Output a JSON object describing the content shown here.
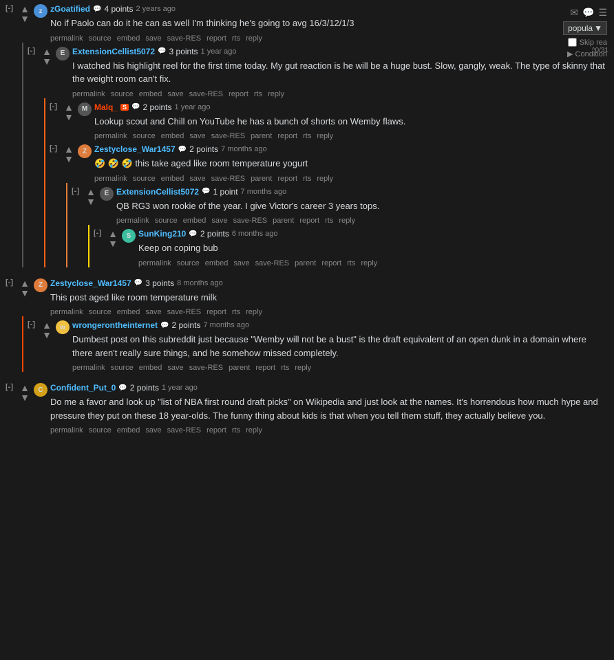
{
  "topRight": {
    "dropdown": "popula",
    "dropdownArrow": "▼",
    "skipRead": "Skip rea",
    "condition": "Condition"
  },
  "counter": "^0/31",
  "comments": [
    {
      "id": "c1",
      "username": "zGoatified",
      "usernameColor": "blue",
      "avatarColor": "blue",
      "avatarInitial": "z",
      "points": "4 points",
      "time": "2 years ago",
      "body": "No if Paolo can do it he can as well I'm thinking he's going to avg 16/3/12/1/3",
      "actions": [
        "permalink",
        "source",
        "embed",
        "save",
        "save-RES",
        "report",
        "rts",
        "reply"
      ],
      "indent": 0,
      "collapseId": "[-]"
    },
    {
      "id": "c2",
      "username": "ExtensionCellist5072",
      "usernameColor": "blue",
      "avatarColor": "dark",
      "avatarInitial": "E",
      "points": "3 points",
      "time": "1 year ago",
      "body": "I watched his highlight reel for the first time today. My gut reaction is he will be a huge bust. Slow, gangly, weak. The type of skinny that the weight room can't fix.",
      "actions": [
        "permalink",
        "source",
        "embed",
        "save",
        "save-RES",
        "report",
        "rts",
        "reply"
      ],
      "indent": 1,
      "collapseId": "[-]"
    },
    {
      "id": "c3",
      "username": "Malq_",
      "usernameColor": "orange",
      "isOP": true,
      "badge": "S",
      "avatarColor": "dark",
      "avatarInitial": "M",
      "points": "2 points",
      "time": "1 year ago",
      "body": "Lookup scout and Chill on YouTube he has a bunch of shorts on Wemby flaws.",
      "actions": [
        "permalink",
        "source",
        "embed",
        "save",
        "save-RES",
        "parent",
        "report",
        "rts",
        "reply"
      ],
      "indent": 2,
      "collapseId": "[-]"
    },
    {
      "id": "c4",
      "username": "Zestyclose_War1457",
      "usernameColor": "blue",
      "avatarColor": "orange",
      "avatarInitial": "Z",
      "points": "2 points",
      "time": "7 months ago",
      "body": "🤣 🤣 🤣 this take aged like room temperature yogurt",
      "actions": [
        "permalink",
        "source",
        "embed",
        "save",
        "save-RES",
        "parent",
        "report",
        "rts",
        "reply"
      ],
      "indent": 2,
      "collapseId": "[-]"
    },
    {
      "id": "c5",
      "username": "ExtensionCellist5072",
      "usernameColor": "blue",
      "avatarColor": "dark",
      "avatarInitial": "E",
      "points": "1 point",
      "time": "7 months ago",
      "body": "QB RG3 won rookie of the year. I give Victor's career 3 years tops.",
      "actions": [
        "permalink",
        "source",
        "embed",
        "save",
        "save-RES",
        "parent",
        "report",
        "rts",
        "reply"
      ],
      "indent": 3,
      "collapseId": "[-]"
    },
    {
      "id": "c6",
      "username": "SunKing210",
      "usernameColor": "blue",
      "avatarColor": "teal",
      "avatarInitial": "S",
      "points": "2 points",
      "time": "6 months ago",
      "body": "Keep on coping bub",
      "actions": [
        "permalink",
        "source",
        "embed",
        "save",
        "save-RES",
        "parent",
        "report",
        "rts",
        "reply"
      ],
      "indent": 4,
      "collapseId": "[-]"
    },
    {
      "id": "c7",
      "username": "Zestyclose_War1457",
      "usernameColor": "blue",
      "avatarColor": "orange",
      "avatarInitial": "Z",
      "points": "3 points",
      "time": "8 months ago",
      "body": "This post aged like room temperature milk",
      "actions": [
        "permalink",
        "source",
        "embed",
        "save",
        "save-RES",
        "report",
        "rts",
        "reply"
      ],
      "indent": 0,
      "collapseId": "[-]"
    },
    {
      "id": "c8",
      "username": "wrongerontheinternet",
      "usernameColor": "blue",
      "avatarColor": "yellow",
      "avatarInitial": "w",
      "points": "2 points",
      "time": "7 months ago",
      "body": "Dumbest post on this subreddit just because \"Wemby will not be a bust\" is the draft equivalent of an open dunk in a domain where there aren't really sure things, and he somehow missed completely.",
      "actions": [
        "permalink",
        "source",
        "embed",
        "save",
        "save-RES",
        "parent",
        "report",
        "rts",
        "reply"
      ],
      "indent": 1,
      "collapseId": "[-]"
    },
    {
      "id": "c9",
      "username": "Confident_Put_0",
      "usernameColor": "blue",
      "avatarColor": "gold",
      "avatarInitial": "C",
      "points": "2 points",
      "time": "1 year ago",
      "body": "Do me a favor and look up \"list of NBA first round draft picks\" on Wikipedia and just look at the names. It's horrendous how much hype and pressure they put on these 18 year-olds. The funny thing about kids is that when you tell them stuff, they actually believe you.",
      "actions": [
        "permalink",
        "source",
        "embed",
        "save",
        "save-RES",
        "report",
        "rts",
        "reply"
      ],
      "indent": 0,
      "collapseId": "[-]"
    }
  ],
  "sourceLabel": "Source"
}
